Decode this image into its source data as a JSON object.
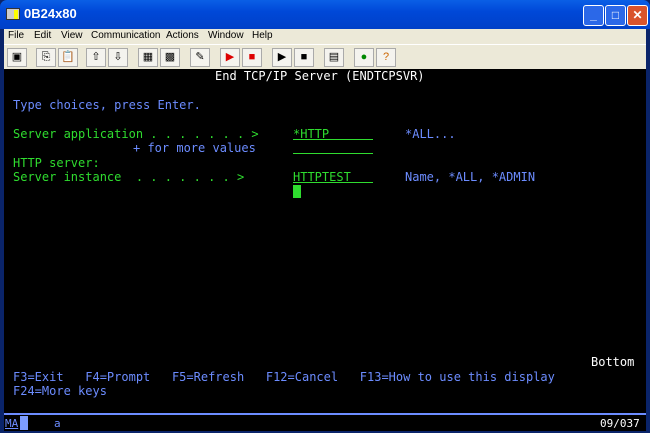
{
  "window": {
    "title": "0B24x80"
  },
  "menu": [
    "File",
    "Edit",
    "View",
    "Communication",
    "Actions",
    "Window",
    "Help"
  ],
  "toolbar_icons": [
    "display-icon",
    "copy-icon",
    "paste-icon",
    "send-icon",
    "receive-icon",
    "color-map-icon",
    "keyboard-map-icon",
    "edit-icon",
    "record-macro-icon",
    "stop-macro-icon",
    "play-macro-icon",
    "pause-macro-icon",
    "clipboard-icon",
    "web-help-icon",
    "help-icon"
  ],
  "screen": {
    "title": "End TCP/IP Server (ENDTCPSVR)",
    "instructions": "Type choices, press Enter.",
    "server_application_label": "Server application . . . . . . . >",
    "server_application_value": "*HTTP",
    "server_application_hint": "*ALL...",
    "more_values": "+ for more values",
    "http_server_label": "HTTP server:",
    "server_instance_label": "Server instance  . . . . . . . >",
    "server_instance_value": "HTTPTEST",
    "server_instance_hint": "Name, *ALL, *ADMIN",
    "bottom": "Bottom",
    "fkeys1": "F3=Exit   F4=Prompt   F5=Refresh   F12=Cancel   F13=How to use this display",
    "fkeys2": "F24=More keys"
  },
  "status": {
    "mode": "MA",
    "indicator": "a",
    "position": "09/037"
  }
}
